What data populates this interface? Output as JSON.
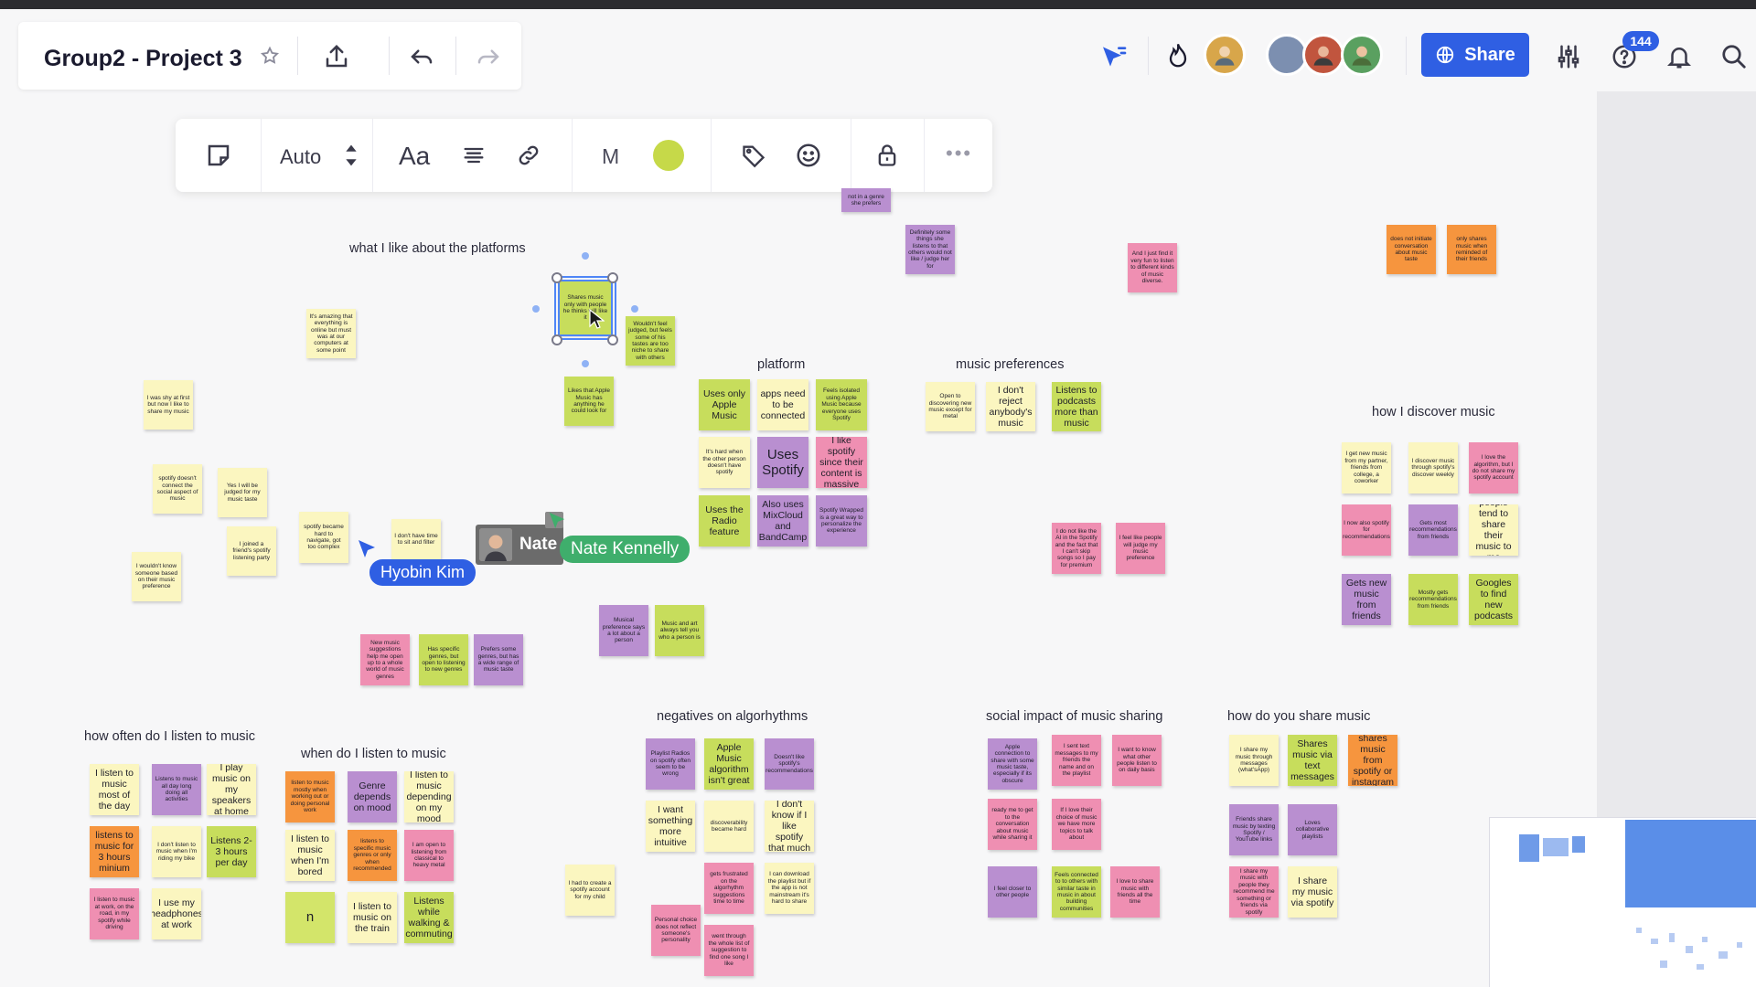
{
  "board": {
    "title": "Group2 - Project 3"
  },
  "header": {
    "share_label": "Share",
    "help_badge": "144",
    "colors": {
      "accent": "#2f5fe3"
    }
  },
  "context_toolbar": {
    "size_mode": "Auto",
    "font_label": "Aa",
    "size_letter": "M",
    "sticky_color": "#c6d949"
  },
  "cursors": [
    {
      "name": "Hyobin Kim",
      "color": "#2f5fe3"
    },
    {
      "name": "Nate",
      "color": "#6b6b6b"
    },
    {
      "name": "Nate Kennelly",
      "color": "#3fae6c"
    }
  ],
  "sections": [
    {
      "title": "what I like about the platforms"
    },
    {
      "title": "platform"
    },
    {
      "title": "music  preferences"
    },
    {
      "title": "how I discover music"
    },
    {
      "title": "how often do I listen to music"
    },
    {
      "title": "when do I listen to music"
    },
    {
      "title": "negatives on algorhythms"
    },
    {
      "title": "social impact of music sharing"
    },
    {
      "title": "how do you share music"
    }
  ],
  "notes": [
    {
      "text": "not in a genre she prefers",
      "color": "p"
    },
    {
      "text": "Definitely some things she listens to that others would not like / judge her for",
      "color": "p"
    },
    {
      "text": "And I just find it very fun to listen to different kinds of music diverse.",
      "color": "pk"
    },
    {
      "text": "does not initiate conversation about music taste",
      "color": "o"
    },
    {
      "text": "only shares music when reminded of their friends",
      "color": "o"
    },
    {
      "text": "Shares music only with people he thinks will like it",
      "color": "g"
    },
    {
      "text": "Wouldn't feel judged, but feels some of his tastes are too niche to share with others",
      "color": "g"
    },
    {
      "text": "It's amazing that everything is online but must was at our computers at some point",
      "color": "y"
    },
    {
      "text": "Likes that Apple Music has anything he could look for",
      "color": "g"
    },
    {
      "text": "I was shy at first but now I like to share my music",
      "color": "y"
    },
    {
      "text": "spotify doesn't connect the social aspect of music",
      "color": "y"
    },
    {
      "text": "Yes I will be judged for my music taste",
      "color": "y"
    },
    {
      "text": "I joined a friend's spotify listening party",
      "color": "y"
    },
    {
      "text": "spotify became hard to navigate, got too complex",
      "color": "y"
    },
    {
      "text": "I don't have time to sit and filter",
      "color": "y"
    },
    {
      "text": "I wouldn't know someone based on their music preference",
      "color": "y"
    },
    {
      "text": "Uses only Apple Music",
      "color": "g"
    },
    {
      "text": "apps need to be connected",
      "color": "y"
    },
    {
      "text": "Feels isolated using Apple Music because everyone uses Spotify",
      "color": "g"
    },
    {
      "text": "It's hard when the other person doesn't have spotify",
      "color": "y"
    },
    {
      "text": "Uses Spotify",
      "color": "p"
    },
    {
      "text": "I like spotify since their content is massive",
      "color": "pk"
    },
    {
      "text": "Uses the Radio feature",
      "color": "g"
    },
    {
      "text": "Also uses MixCloud and BandCamp",
      "color": "p"
    },
    {
      "text": "Spotify Wrapped is a great way to personalize the experience",
      "color": "p"
    },
    {
      "text": "Open to discovering new music except for metal",
      "color": "y"
    },
    {
      "text": "I don't reject anybody's music",
      "color": "y"
    },
    {
      "text": "Listens to podcasts more than music",
      "color": "g"
    },
    {
      "text": "I do not like the AI in the Spotify and the fact that I can't skip songs so I pay for premium",
      "color": "pk"
    },
    {
      "text": "I feel like people will judge my music preference",
      "color": "pk"
    },
    {
      "text": "Musical preference says a lot about a person",
      "color": "p"
    },
    {
      "text": "Music and art always tell you who a person is",
      "color": "g"
    },
    {
      "text": "New music suggestions help me open up to a whole world of music genres",
      "color": "pk"
    },
    {
      "text": "Has specific genres, but open to listening to new genres",
      "color": "g"
    },
    {
      "text": "Prefers some genres, but has a wide range of music taste",
      "color": "p"
    },
    {
      "text": "I get new music from my partner, friends from college, a coworker",
      "color": "y"
    },
    {
      "text": "I discover music through spotify's discover weekly",
      "color": "y"
    },
    {
      "text": "I love the algorithm, but I do not share my spotify account",
      "color": "pk"
    },
    {
      "text": "I now also spotify for recommendations",
      "color": "pk"
    },
    {
      "text": "Gets most recommendations from friends",
      "color": "p"
    },
    {
      "text": "people tend to share their music to me",
      "color": "y"
    },
    {
      "text": "Gets new music from friends",
      "color": "p"
    },
    {
      "text": "Mostly gets recommendations from friends",
      "color": "g"
    },
    {
      "text": "Googles to find new podcasts",
      "color": "g"
    },
    {
      "text": "I listen to music most of the day",
      "color": "y"
    },
    {
      "text": "Listens to music all day long doing all activities",
      "color": "p"
    },
    {
      "text": "I play music on my speakers at home",
      "color": "y"
    },
    {
      "text": "listens to music for 3 hours minium",
      "color": "o"
    },
    {
      "text": "I don't listen to music when I'm riding my bike",
      "color": "y"
    },
    {
      "text": "Listens 2-3 hours per day",
      "color": "g"
    },
    {
      "text": "I listen to music at work, on the road, in my spotify while driving",
      "color": "pk"
    },
    {
      "text": "I use my headphones at work",
      "color": "y"
    },
    {
      "text": "listen to music mostly when working out or doing personal work",
      "color": "o"
    },
    {
      "text": "Genre depends on mood",
      "color": "p"
    },
    {
      "text": "I listen to music depending on my mood",
      "color": "y"
    },
    {
      "text": "I listen to music when I'm bored",
      "color": "y"
    },
    {
      "text": "listens to specific music genres or only when recommended",
      "color": "o"
    },
    {
      "text": "I am open to listening from classical to heavy metal",
      "color": "pk"
    },
    {
      "text": "n",
      "color": "lg"
    },
    {
      "text": "I listen to music on the train",
      "color": "y"
    },
    {
      "text": "Listens while walking & commuting",
      "color": "g"
    },
    {
      "text": "Playlist Radios on spotify often seem to be wrong",
      "color": "p"
    },
    {
      "text": "Apple Music algorithm isn't great",
      "color": "g"
    },
    {
      "text": "Doesn't like spotify's recommendations",
      "color": "p"
    },
    {
      "text": "I want something more intuitive",
      "color": "y"
    },
    {
      "text": "discoverability became hard",
      "color": "y"
    },
    {
      "text": "I don't know if I like spotify that much",
      "color": "y"
    },
    {
      "text": "I had to create a spotify account for my child",
      "color": "y"
    },
    {
      "text": "gets frustrated on the algorhythm suggestions time to time",
      "color": "pk"
    },
    {
      "text": "I can download the playlist but if the app is not mainstream it's hard to share",
      "color": "y"
    },
    {
      "text": "Personal choice does not reflect someone's personality",
      "color": "pk"
    },
    {
      "text": "went through the whole list of suggestion to find one song I like",
      "color": "pk"
    },
    {
      "text": "Apple connection to share with some music taste, especially if its obscure",
      "color": "p"
    },
    {
      "text": "I sent text messages to my friends the name and on the playlist",
      "color": "pk"
    },
    {
      "text": "I want to know what other people listen to on daily basis",
      "color": "pk"
    },
    {
      "text": "ready me to get to the conversation about music while sharing it",
      "color": "pk"
    },
    {
      "text": "If I love their choice of music we have more topics to talk about",
      "color": "pk"
    },
    {
      "text": "I feel closer to other people",
      "color": "p"
    },
    {
      "text": "Feels connected to to others with similar taste in music in about building communities",
      "color": "g"
    },
    {
      "text": "I love to share music with friends all the time",
      "color": "pk"
    },
    {
      "text": "I share my music through messages (what'sApp)",
      "color": "y"
    },
    {
      "text": "Shares music via text messages",
      "color": "g"
    },
    {
      "text": "shares music from spotify or instagram",
      "color": "o"
    },
    {
      "text": "Friends share music by texting Spotify / YouTube links",
      "color": "p"
    },
    {
      "text": "Loves collaborative playlists",
      "color": "p"
    },
    {
      "text": "I share my music with people they recommend me something or friends via spotify",
      "color": "pk"
    },
    {
      "text": "I share my music via spotify",
      "color": "y"
    }
  ]
}
